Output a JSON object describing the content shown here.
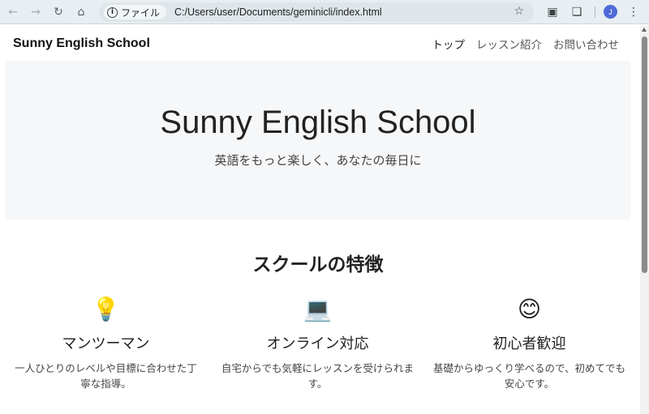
{
  "browser": {
    "file_label": "ファイル",
    "url": "C:/Users/user/Documents/geminicli/index.html",
    "avatar_initial": "J"
  },
  "site": {
    "brand": "Sunny English School",
    "nav": [
      {
        "label": "トップ"
      },
      {
        "label": "レッスン紹介"
      },
      {
        "label": "お問い合わせ"
      }
    ]
  },
  "hero": {
    "title": "Sunny English School",
    "subtitle": "英語をもっと楽しく、あなたの毎日に"
  },
  "features": {
    "title": "スクールの特徴",
    "items": [
      {
        "icon": "💡",
        "icon_name": "light-bulb-icon",
        "title": "マンツーマン",
        "text": "一人ひとりのレベルや目標に合わせた丁寧な指導。"
      },
      {
        "icon": "💻",
        "icon_name": "laptop-icon",
        "title": "オンライン対応",
        "text": "自宅からでも気軽にレッスンを受けられます。"
      },
      {
        "icon": "😊",
        "icon_name": "smiling-face-icon",
        "title": "初心者歓迎",
        "text": "基礎からゆっくり学べるので、初めてでも安心です。"
      }
    ]
  }
}
